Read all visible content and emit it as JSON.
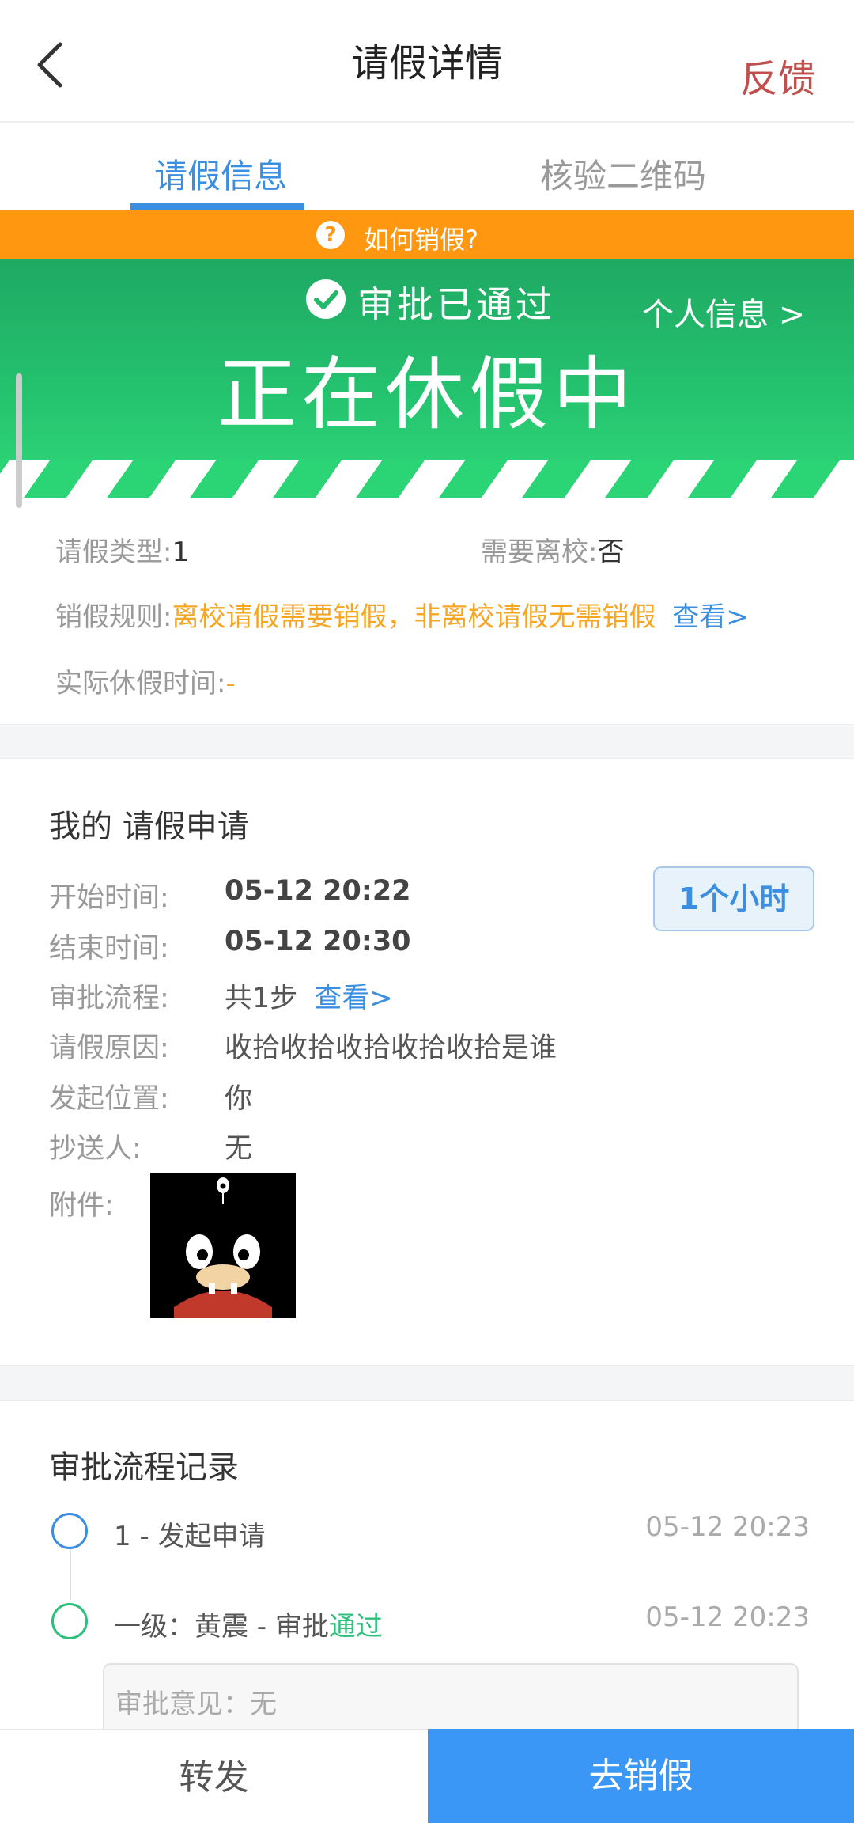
{
  "header": {
    "title": "请假详情",
    "feedback": "反馈"
  },
  "tabs": [
    {
      "label": "请假信息"
    },
    {
      "label": "核验二维码"
    }
  ],
  "notice": {
    "label": "如何销假?"
  },
  "banner": {
    "status": "审批已通过",
    "personal_info": "个人信息 >",
    "main_text": "正在休假中"
  },
  "info": {
    "type_label": "请假类型:",
    "type_value": "1",
    "leave_school_label": "需要离校:",
    "leave_school_value": "否",
    "rule_label": "销假规则:",
    "rule_value": "离校请假需要销假，非离校请假无需销假",
    "rule_link": "查看>",
    "actual_label": "实际休假时间:",
    "actual_value": "-"
  },
  "application": {
    "title": "我的 请假申请",
    "duration": "1个小时",
    "start_label": "开始时间:",
    "start_value": "05-12 20:22",
    "end_label": "结束时间:",
    "end_value": "05-12 20:30",
    "flow_label": "审批流程:",
    "flow_value": "共1步",
    "flow_link": "查看>",
    "reason_label": "请假原因:",
    "reason_value": "收拾收拾收拾收拾收拾是谁",
    "location_label": "发起位置:",
    "location_value": "你",
    "cc_label": "抄送人:",
    "cc_value": "无",
    "attachment_label": "附件:"
  },
  "record": {
    "title": "审批流程记录",
    "steps": [
      {
        "text": "1 - 发起申请",
        "time": "05-12 20:23"
      },
      {
        "text": "一级：黄震 - 审批",
        "result": "通过",
        "time": "05-12 20:23"
      }
    ],
    "opinion": "审批意见：无"
  },
  "bottom": {
    "forward": "转发",
    "cancel_leave": "去销假"
  },
  "colors": {
    "accent": "#3c8ee0",
    "green": "#24c26f",
    "orange": "#ff9810",
    "primary_button": "#3b97f5",
    "feedback": "#c0504d"
  }
}
